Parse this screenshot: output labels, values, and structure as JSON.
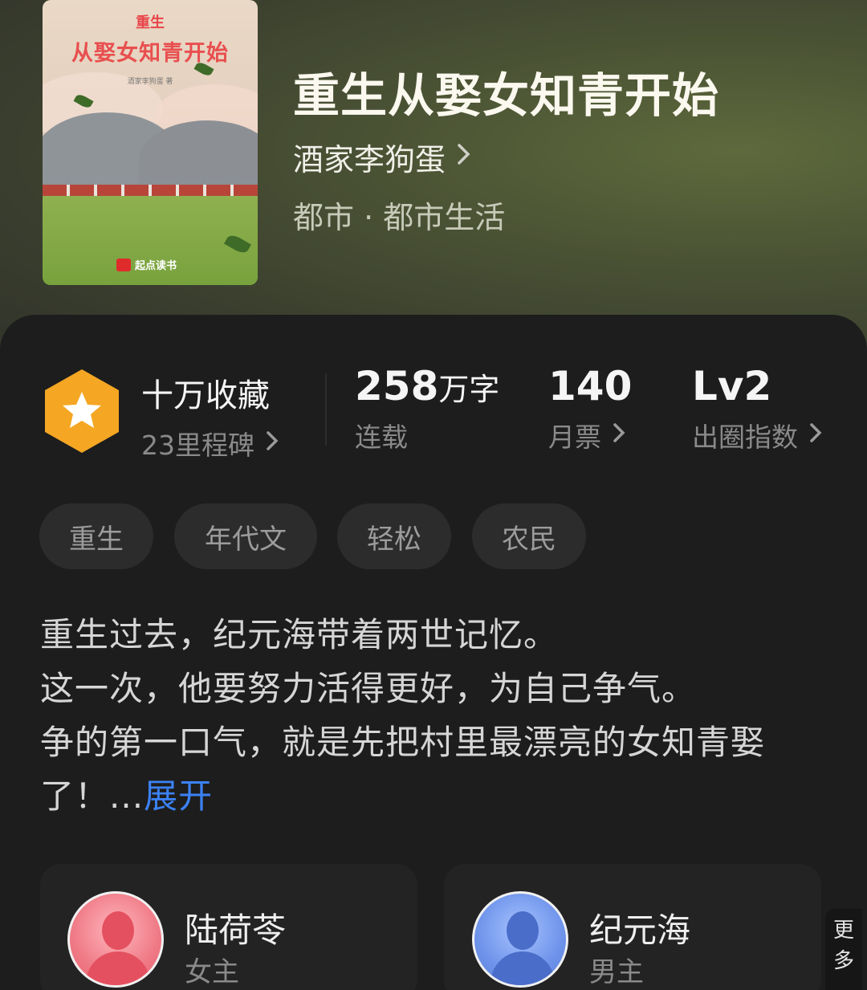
{
  "book": {
    "title": "重生从娶女知青开始",
    "author": "酒家李狗蛋",
    "category": "都市 · 都市生活",
    "cover": {
      "top_text": "重生",
      "title_text": "从娶女知青开始",
      "author_text": "酒家李狗蛋 著",
      "publisher": "起点读书"
    }
  },
  "stats": {
    "favorites": {
      "value": "十万收藏",
      "sub": "23里程碑"
    },
    "words": {
      "number": "258",
      "unit": "万字",
      "sub": "连载"
    },
    "monthly_votes": {
      "value": "140",
      "sub": "月票"
    },
    "level": {
      "value": "Lv2",
      "sub": "出圈指数"
    }
  },
  "tags": [
    "重生",
    "年代文",
    "轻松",
    "农民"
  ],
  "description": {
    "lines": [
      "重生过去，纪元海带着两世记忆。",
      "这一次，他要努力活得更好，为自己争气。",
      "争的第一口气，就是先把村里最漂亮的女知青娶",
      "了！..."
    ],
    "expand_label": "展开"
  },
  "characters": [
    {
      "name": "陆荷苓",
      "role": "女主"
    },
    {
      "name": "纪元海",
      "role": "男主"
    }
  ],
  "more_label": "更多",
  "colors": {
    "accent_blue": "#3b82f6",
    "badge_orange": "#f5a623"
  }
}
